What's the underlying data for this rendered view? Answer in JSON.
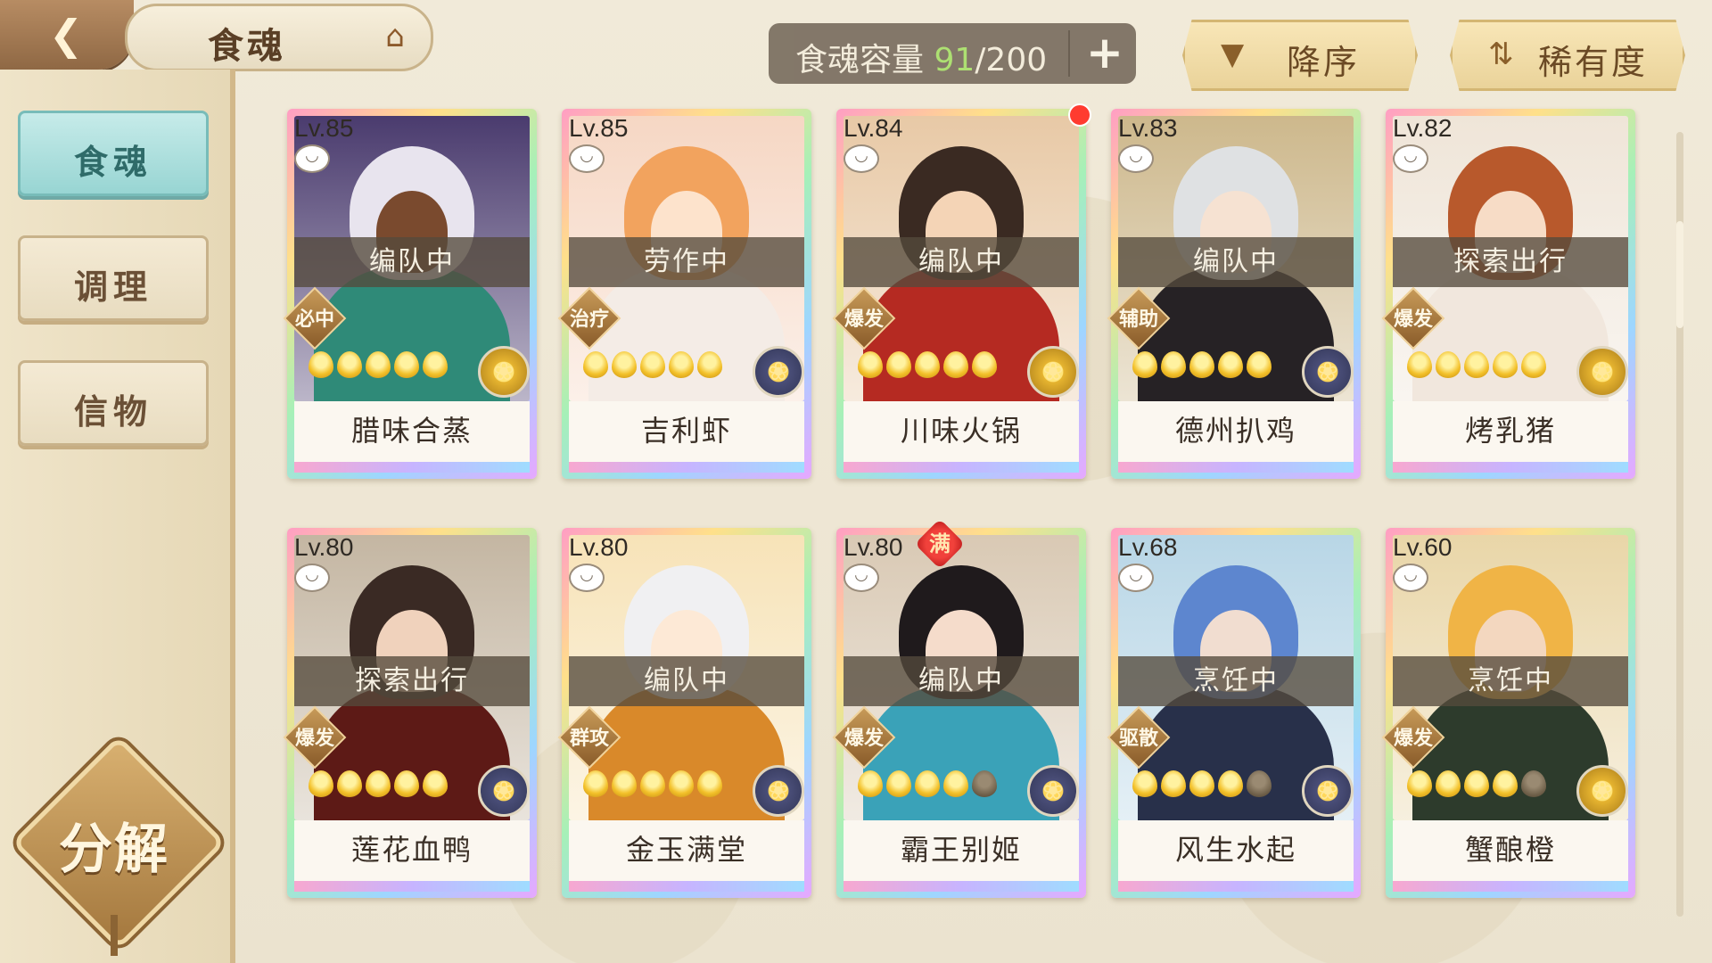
{
  "header": {
    "back_icon": "back-arrow-icon",
    "title": "食魂",
    "home_icon": "pavilion-icon",
    "capacity_label": "食魂容量",
    "capacity_current": "91",
    "capacity_total": "/200",
    "add_label": "+",
    "sort_order": {
      "icon": "triangle-down-icon",
      "label": "降序"
    },
    "sort_key": {
      "icon": "swap-icon",
      "label": "稀有度"
    }
  },
  "sidebar": {
    "items": [
      {
        "label": "食魂",
        "active": true
      },
      {
        "label": "调理",
        "active": false
      },
      {
        "label": "信物",
        "active": false
      }
    ],
    "decompose_label": "分解"
  },
  "cards": [
    {
      "level": "Lv.85",
      "status": "编队中",
      "role": "必中",
      "stars": 5,
      "max_stars": 5,
      "name": "腊味合蒸",
      "bg": "#4a3b6e",
      "skin": "#7a4a2e",
      "hair": "#e8e4ee",
      "outfit": "#2f8a78",
      "emblem": "gold",
      "notify": false,
      "full": false
    },
    {
      "level": "Lv.85",
      "status": "劳作中",
      "role": "治疗",
      "stars": 5,
      "max_stars": 5,
      "name": "吉利虾",
      "bg": "#f6d7c4",
      "skin": "#fde3cc",
      "hair": "#f2a35e",
      "outfit": "#f4ece6",
      "emblem": "blue",
      "notify": false,
      "full": false
    },
    {
      "level": "Lv.84",
      "status": "编队中",
      "role": "爆发",
      "stars": 5,
      "max_stars": 5,
      "name": "川味火锅",
      "bg": "#e8c9a6",
      "skin": "#f4d4b6",
      "hair": "#3a2a22",
      "outfit": "#b52a22",
      "emblem": "gold",
      "notify": true,
      "full": false
    },
    {
      "level": "Lv.83",
      "status": "编队中",
      "role": "辅助",
      "stars": 5,
      "max_stars": 5,
      "name": "德州扒鸡",
      "bg": "#cdb88c",
      "skin": "#f6e2d2",
      "hair": "#dfe1e3",
      "outfit": "#262225",
      "emblem": "blue",
      "notify": false,
      "full": false
    },
    {
      "level": "Lv.82",
      "status": "探索出行",
      "role": "爆发",
      "stars": 5,
      "max_stars": 5,
      "name": "烤乳猪",
      "bg": "#efe5d8",
      "skin": "#f7dcc6",
      "hair": "#b8592c",
      "outfit": "#f1e7dd",
      "emblem": "gold",
      "notify": false,
      "full": false
    },
    {
      "level": "Lv.80",
      "status": "探索出行",
      "role": "爆发",
      "stars": 5,
      "max_stars": 5,
      "name": "莲花血鸭",
      "bg": "#c4b6a2",
      "skin": "#f0d2bc",
      "hair": "#3a2a24",
      "outfit": "#5d1a16",
      "emblem": "blue",
      "notify": false,
      "full": false
    },
    {
      "level": "Lv.80",
      "status": "编队中",
      "role": "群攻",
      "stars": 5,
      "max_stars": 5,
      "name": "金玉满堂",
      "bg": "#f7e3b8",
      "skin": "#fde9d6",
      "hair": "#f0f0f2",
      "outfit": "#d9892a",
      "emblem": "blue",
      "notify": false,
      "full": false
    },
    {
      "level": "Lv.80",
      "status": "编队中",
      "role": "爆发",
      "stars": 4,
      "max_stars": 5,
      "name": "霸王别姬",
      "bg": "#d9c9b4",
      "skin": "#f5dccb",
      "hair": "#1f1a1c",
      "outfit": "#3aa2b8",
      "emblem": "blue",
      "notify": false,
      "full": true,
      "full_label": "满"
    },
    {
      "level": "Lv.68",
      "status": "烹饪中",
      "role": "驱散",
      "stars": 4,
      "max_stars": 5,
      "name": "风生水起",
      "bg": "#b8d6e6",
      "skin": "#f1ddd0",
      "hair": "#5d86cf",
      "outfit": "#28304a",
      "emblem": "blue",
      "notify": false,
      "full": false
    },
    {
      "level": "Lv.60",
      "status": "烹饪中",
      "role": "爆发",
      "stars": 4,
      "max_stars": 5,
      "name": "蟹酿橙",
      "bg": "#e9d6a8",
      "skin": "#f3d7bf",
      "hair": "#f0b446",
      "outfit": "#2d3b2c",
      "emblem": "gold",
      "notify": false,
      "full": false
    }
  ]
}
